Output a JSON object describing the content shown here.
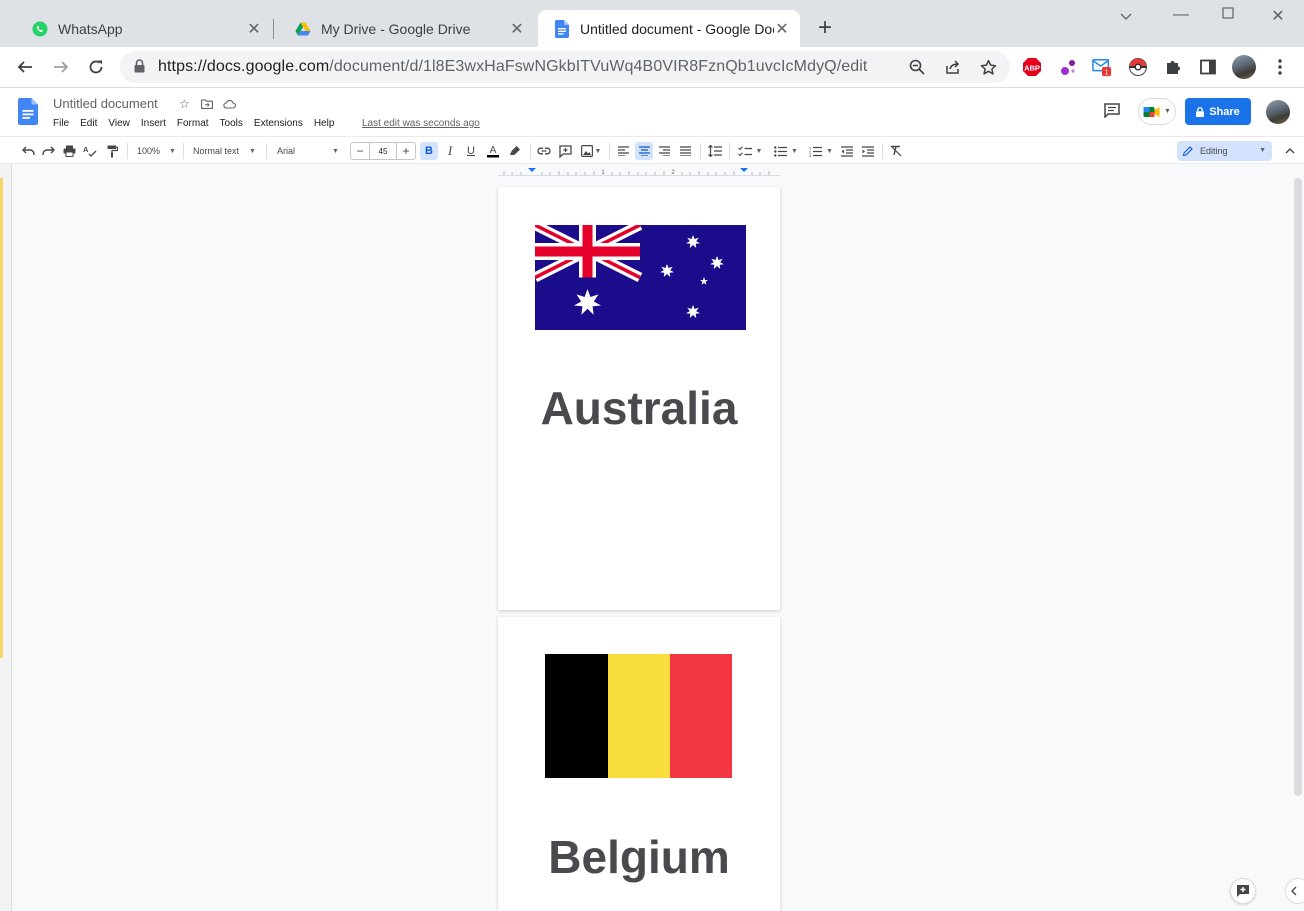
{
  "browser": {
    "tabs": [
      {
        "title": "WhatsApp",
        "icon": "whatsapp-icon",
        "active": false
      },
      {
        "title": "My Drive - Google Drive",
        "icon": "google-drive-icon",
        "active": false
      },
      {
        "title": "Untitled document - Google Docs",
        "icon": "google-docs-icon",
        "active": true
      }
    ],
    "url_host": "https://docs.google.com",
    "url_path": "/document/d/1l8E3wxHaFswNGkbITVuWq4B0VIR8FznQb1uvcIcMdyQ/edit",
    "extensions": [
      "adblock-plus-icon",
      "purple-dots-extension-icon",
      "mail-checker-icon",
      "pokeball-extension-icon",
      "puzzle-extensions-icon",
      "side-panel-icon"
    ],
    "mail_badge": "1"
  },
  "docs": {
    "title": "Untitled document",
    "menu": [
      "File",
      "Edit",
      "View",
      "Insert",
      "Format",
      "Tools",
      "Extensions",
      "Help"
    ],
    "last_edit": "Last edit was seconds ago",
    "share_label": "Share",
    "toolbar": {
      "zoom": "100%",
      "style": "Normal text",
      "font": "Arial",
      "font_size": "45",
      "mode": "Editing"
    },
    "accent_color": "#1a73e8"
  },
  "pages": [
    {
      "flag": "australia",
      "country": "Australia"
    },
    {
      "flag": "belgium",
      "country": "Belgium"
    }
  ],
  "ruler_numbers": [
    "1",
    "2"
  ]
}
